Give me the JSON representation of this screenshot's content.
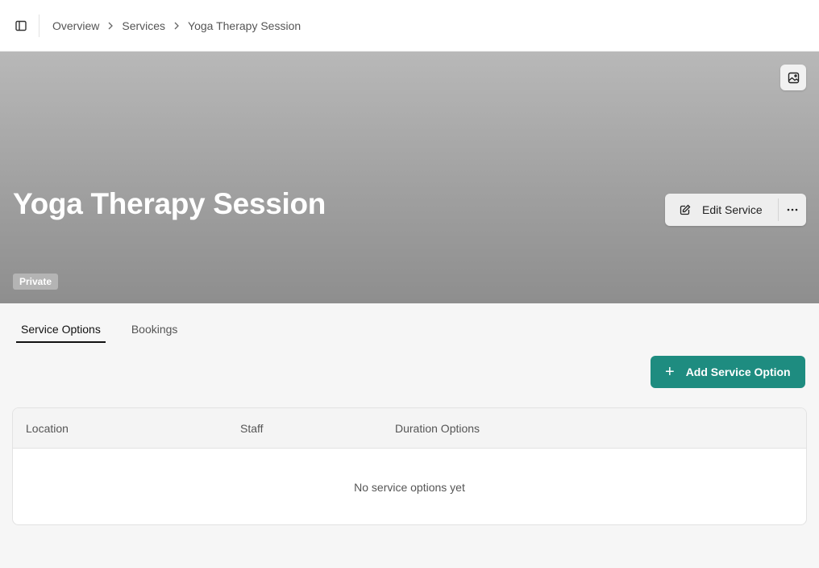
{
  "breadcrumb": {
    "items": [
      "Overview",
      "Services",
      "Yoga Therapy Session"
    ]
  },
  "hero": {
    "title": "Yoga Therapy Session",
    "badge": "Private",
    "edit_label": "Edit Service"
  },
  "tabs": [
    {
      "label": "Service Options",
      "active": true
    },
    {
      "label": "Bookings",
      "active": false
    }
  ],
  "actions": {
    "add_label": "Add Service Option"
  },
  "table": {
    "columns": [
      "Location",
      "Staff",
      "Duration Options"
    ],
    "empty_text": "No service options yet"
  },
  "colors": {
    "accent": "#1e8c80",
    "hero_top": "#b8b8b8",
    "hero_bottom": "#8e8e8e"
  }
}
